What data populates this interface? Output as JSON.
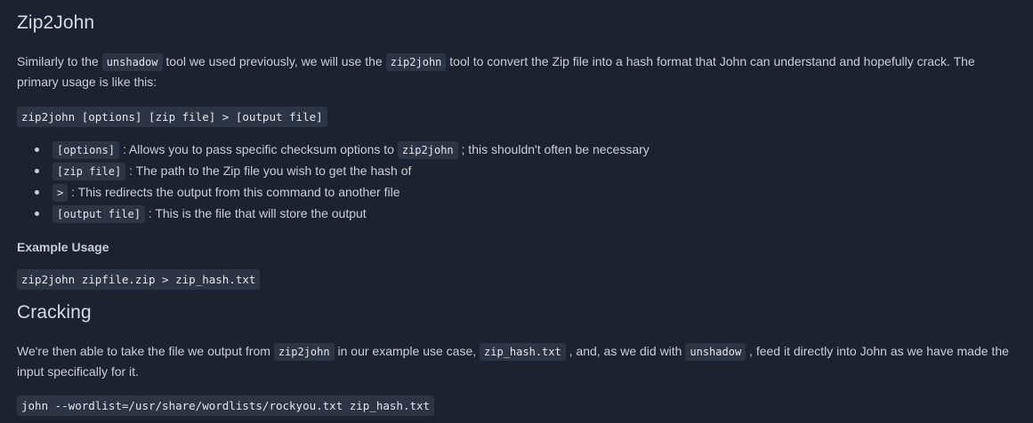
{
  "section1": {
    "title": "Zip2John",
    "intro": {
      "t1": "Similarly to the ",
      "c1": "unshadow",
      "t2": " tool we used previously, we will use the ",
      "c2": "zip2john",
      "t3": " tool to convert the Zip file into a hash format that John can understand and hopefully crack. The primary usage is like this:"
    },
    "usage_code": "zip2john [options] [zip file] > [output file]",
    "options": [
      {
        "code": "[options]",
        "pre": " : Allows you to pass specific checksum options to ",
        "code2": "zip2john",
        "post": " ; this shouldn't often be necessary"
      },
      {
        "code": "[zip file]",
        "text": " : The path to the Zip file you wish to get the hash of"
      },
      {
        "code": ">",
        "text": " : This redirects the output from this command to another file"
      },
      {
        "code": "[output file]",
        "text": " : This is the file that will store the output"
      }
    ],
    "example_heading": "Example Usage",
    "example_code": "zip2john zipfile.zip > zip_hash.txt"
  },
  "section2": {
    "title": "Cracking",
    "para": {
      "t1": "We're then able to take the file we output from ",
      "c1": "zip2john",
      "t2": " in our example use case, ",
      "c2": "zip_hash.txt",
      "t3": " , and, as we did with ",
      "c3": "unshadow",
      "t4": " , feed it directly into John as we have made the input specifically for it."
    },
    "command_code": "john --wordlist=/usr/share/wordlists/rockyou.txt zip_hash.txt"
  }
}
